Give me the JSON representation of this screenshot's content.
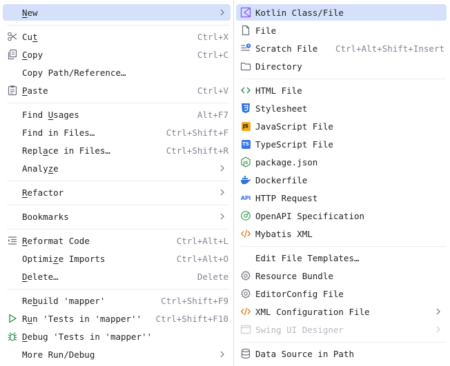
{
  "left_menu": {
    "new": {
      "pre": "",
      "u": "N",
      "post": "ew"
    },
    "cut": {
      "pre": "Cu",
      "u": "t",
      "post": "",
      "shortcut": "Ctrl+X"
    },
    "copy": {
      "pre": "",
      "u": "C",
      "post": "opy",
      "shortcut": "Ctrl+C"
    },
    "copy_path": {
      "label": "Copy Path/Reference…"
    },
    "paste": {
      "pre": "",
      "u": "P",
      "post": "aste",
      "shortcut": "Ctrl+V"
    },
    "find_usages": {
      "pre": "Find ",
      "u": "U",
      "post": "sages",
      "shortcut": "Alt+F7"
    },
    "find_in_files": {
      "label": "Find in Files…",
      "shortcut": "Ctrl+Shift+F"
    },
    "replace_in_files": {
      "pre": "Repl",
      "u": "a",
      "post": "ce in Files…",
      "shortcut": "Ctrl+Shift+R"
    },
    "analyze": {
      "pre": "Analy",
      "u": "z",
      "post": "e"
    },
    "refactor": {
      "pre": "",
      "u": "R",
      "post": "efactor"
    },
    "bookmarks": {
      "label": "Bookmarks"
    },
    "reformat_code": {
      "pre": "",
      "u": "R",
      "post": "eformat Code",
      "shortcut": "Ctrl+Alt+L"
    },
    "optimize_imports": {
      "pre": "Optimi",
      "u": "z",
      "post": "e Imports",
      "shortcut": "Ctrl+Alt+O"
    },
    "delete": {
      "pre": "",
      "u": "D",
      "post": "elete…",
      "shortcut": "Delete"
    },
    "rebuild": {
      "pre": "Re",
      "u": "b",
      "post": "uild 'mapper'",
      "shortcut": "Ctrl+Shift+F9"
    },
    "run_tests": {
      "pre": "R",
      "u": "u",
      "post": "n 'Tests in 'mapper''",
      "shortcut": "Ctrl+Shift+F10"
    },
    "debug_tests": {
      "pre": "",
      "u": "D",
      "post": "ebug 'Tests in 'mapper''"
    },
    "more_run_debug": {
      "label": "More Run/Debug"
    }
  },
  "right_menu": {
    "kotlin_class": {
      "label": "Kotlin Class/File"
    },
    "file": {
      "label": "File"
    },
    "scratch_file": {
      "label": "Scratch File",
      "shortcut": "Ctrl+Alt+Shift+Insert"
    },
    "directory": {
      "label": "Directory"
    },
    "html_file": {
      "label": "HTML File"
    },
    "stylesheet": {
      "label": "Stylesheet"
    },
    "javascript_file": {
      "label": "JavaScript File"
    },
    "typescript_file": {
      "label": "TypeScript File"
    },
    "package_json": {
      "label": "package.json"
    },
    "dockerfile": {
      "label": "Dockerfile"
    },
    "http_request": {
      "label": "HTTP Request"
    },
    "openapi_spec": {
      "label": "OpenAPI Specification"
    },
    "mybatis_xml": {
      "label": "Mybatis XML"
    },
    "edit_templates": {
      "label": "Edit File Templates…"
    },
    "resource_bundle": {
      "label": "Resource Bundle"
    },
    "editorconfig": {
      "label": "EditorConfig File"
    },
    "xml_config": {
      "label": "XML Configuration File"
    },
    "swing_designer": {
      "label": "Swing UI Designer"
    },
    "data_source": {
      "label": "Data Source in Path"
    }
  },
  "icon_text": {
    "js": "JS",
    "ts": "TS",
    "api": "API"
  },
  "colors": {
    "highlight": "#d5e1fb",
    "shortcut": "#818594",
    "disabled": "#b7b9c0",
    "separator": "#ebecf0"
  }
}
